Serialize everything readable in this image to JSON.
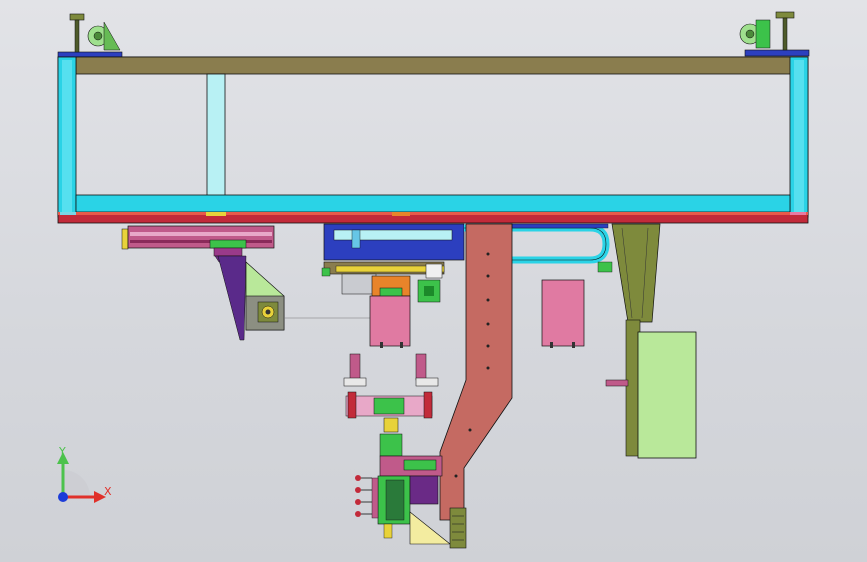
{
  "viewport": {
    "background_top": "#e2e3e7",
    "background_bottom": "#cfd1d6"
  },
  "triad": {
    "y_label": "Y",
    "x_label": "X",
    "y_color": "#4cc24c",
    "x_color": "#e0302a",
    "origin_color": "#1c3cd8"
  },
  "colors": {
    "frame_cyan": "#2ad3e6",
    "beam_olive": "#8a7d4e",
    "light_cyan": "#b8f1f4",
    "red_rail": "#c22a3a",
    "brown_arm": "#c56a62",
    "pink_block": "#e07aa2",
    "light_green": "#b9e89a",
    "olive_green": "#7e8a3c",
    "blue_plate": "#2c3fbf",
    "purple": "#6a2a86",
    "yellow": "#e8d23a",
    "green": "#3cc24a"
  }
}
